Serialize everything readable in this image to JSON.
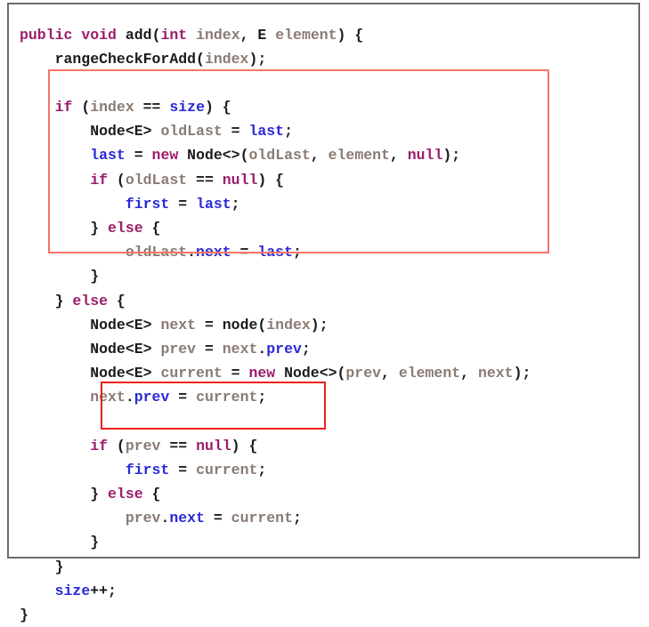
{
  "figure": {
    "kind": "java-source-code-listing",
    "language": "Java",
    "method_signature": "public void add(int index, E element)",
    "border_color": "#6b6b6b",
    "background_color": "#ffffff"
  },
  "syntax_colors": {
    "keyword": "#9B1D6B",
    "field": "#2A2AD6",
    "local_variable": "#8A7B72",
    "plain": "#1b1b1b"
  },
  "annotations": [
    {
      "name": "append-at-tail-highlight",
      "border_color": "#F4756B",
      "covers": "if (index == size) { ... } block"
    },
    {
      "name": "insert-at-head-highlight",
      "border_color": "#F0201C",
      "covers": "if (prev == null) { first = current; }"
    }
  ],
  "code": {
    "lines": [
      [
        {
          "t": "public",
          "c": "kw"
        },
        {
          "t": " ",
          "c": "plain"
        },
        {
          "t": "void",
          "c": "kw"
        },
        {
          "t": " ",
          "c": "plain"
        },
        {
          "t": "add",
          "c": "plain"
        },
        {
          "t": "(",
          "c": "plain"
        },
        {
          "t": "int",
          "c": "kw"
        },
        {
          "t": " ",
          "c": "plain"
        },
        {
          "t": "index",
          "c": "local"
        },
        {
          "t": ", ",
          "c": "plain"
        },
        {
          "t": "E",
          "c": "plain"
        },
        {
          "t": " ",
          "c": "plain"
        },
        {
          "t": "element",
          "c": "local"
        },
        {
          "t": ") {",
          "c": "plain"
        }
      ],
      [
        {
          "t": "    rangeCheckForAdd",
          "c": "plain"
        },
        {
          "t": "(",
          "c": "plain"
        },
        {
          "t": "index",
          "c": "local"
        },
        {
          "t": ");",
          "c": "plain"
        }
      ],
      [],
      [
        {
          "t": "    ",
          "c": "plain"
        },
        {
          "t": "if",
          "c": "kw"
        },
        {
          "t": " (",
          "c": "plain"
        },
        {
          "t": "index",
          "c": "local"
        },
        {
          "t": " == ",
          "c": "plain"
        },
        {
          "t": "size",
          "c": "field"
        },
        {
          "t": ") {",
          "c": "plain"
        }
      ],
      [
        {
          "t": "        Node<E> ",
          "c": "plain"
        },
        {
          "t": "oldLast",
          "c": "local"
        },
        {
          "t": " = ",
          "c": "plain"
        },
        {
          "t": "last",
          "c": "field"
        },
        {
          "t": ";",
          "c": "plain"
        }
      ],
      [
        {
          "t": "        ",
          "c": "plain"
        },
        {
          "t": "last",
          "c": "field"
        },
        {
          "t": " = ",
          "c": "plain"
        },
        {
          "t": "new",
          "c": "kw"
        },
        {
          "t": " Node<>(",
          "c": "plain"
        },
        {
          "t": "oldLast",
          "c": "local"
        },
        {
          "t": ", ",
          "c": "plain"
        },
        {
          "t": "element",
          "c": "local"
        },
        {
          "t": ", ",
          "c": "plain"
        },
        {
          "t": "null",
          "c": "kw"
        },
        {
          "t": ");",
          "c": "plain"
        }
      ],
      [
        {
          "t": "        ",
          "c": "plain"
        },
        {
          "t": "if",
          "c": "kw"
        },
        {
          "t": " (",
          "c": "plain"
        },
        {
          "t": "oldLast",
          "c": "local"
        },
        {
          "t": " == ",
          "c": "plain"
        },
        {
          "t": "null",
          "c": "kw"
        },
        {
          "t": ") {",
          "c": "plain"
        }
      ],
      [
        {
          "t": "            ",
          "c": "plain"
        },
        {
          "t": "first",
          "c": "field"
        },
        {
          "t": " = ",
          "c": "plain"
        },
        {
          "t": "last",
          "c": "field"
        },
        {
          "t": ";",
          "c": "plain"
        }
      ],
      [
        {
          "t": "        } ",
          "c": "plain"
        },
        {
          "t": "else",
          "c": "kw"
        },
        {
          "t": " {",
          "c": "plain"
        }
      ],
      [
        {
          "t": "            ",
          "c": "plain"
        },
        {
          "t": "oldLast",
          "c": "local"
        },
        {
          "t": ".",
          "c": "plain"
        },
        {
          "t": "next",
          "c": "field"
        },
        {
          "t": " = ",
          "c": "plain"
        },
        {
          "t": "last",
          "c": "field"
        },
        {
          "t": ";",
          "c": "plain"
        }
      ],
      [
        {
          "t": "        }",
          "c": "plain"
        }
      ],
      [
        {
          "t": "    } ",
          "c": "plain"
        },
        {
          "t": "else",
          "c": "kw"
        },
        {
          "t": " {",
          "c": "plain"
        }
      ],
      [
        {
          "t": "        Node<E> ",
          "c": "plain"
        },
        {
          "t": "next",
          "c": "local"
        },
        {
          "t": " = ",
          "c": "plain"
        },
        {
          "t": "node",
          "c": "plain"
        },
        {
          "t": "(",
          "c": "plain"
        },
        {
          "t": "index",
          "c": "local"
        },
        {
          "t": ");",
          "c": "plain"
        }
      ],
      [
        {
          "t": "        Node<E> ",
          "c": "plain"
        },
        {
          "t": "prev",
          "c": "local"
        },
        {
          "t": " = ",
          "c": "plain"
        },
        {
          "t": "next",
          "c": "local"
        },
        {
          "t": ".",
          "c": "plain"
        },
        {
          "t": "prev",
          "c": "field"
        },
        {
          "t": ";",
          "c": "plain"
        }
      ],
      [
        {
          "t": "        Node<E> ",
          "c": "plain"
        },
        {
          "t": "current",
          "c": "local"
        },
        {
          "t": " = ",
          "c": "plain"
        },
        {
          "t": "new",
          "c": "kw"
        },
        {
          "t": " Node<>(",
          "c": "plain"
        },
        {
          "t": "prev",
          "c": "local"
        },
        {
          "t": ", ",
          "c": "plain"
        },
        {
          "t": "element",
          "c": "local"
        },
        {
          "t": ", ",
          "c": "plain"
        },
        {
          "t": "next",
          "c": "local"
        },
        {
          "t": ");",
          "c": "plain"
        }
      ],
      [
        {
          "t": "        ",
          "c": "plain"
        },
        {
          "t": "next",
          "c": "local"
        },
        {
          "t": ".",
          "c": "plain"
        },
        {
          "t": "prev",
          "c": "field"
        },
        {
          "t": " = ",
          "c": "plain"
        },
        {
          "t": "current",
          "c": "local"
        },
        {
          "t": ";",
          "c": "plain"
        }
      ],
      [],
      [
        {
          "t": "        ",
          "c": "plain"
        },
        {
          "t": "if",
          "c": "kw"
        },
        {
          "t": " (",
          "c": "plain"
        },
        {
          "t": "prev",
          "c": "local"
        },
        {
          "t": " == ",
          "c": "plain"
        },
        {
          "t": "null",
          "c": "kw"
        },
        {
          "t": ") {",
          "c": "plain"
        }
      ],
      [
        {
          "t": "            ",
          "c": "plain"
        },
        {
          "t": "first",
          "c": "field"
        },
        {
          "t": " = ",
          "c": "plain"
        },
        {
          "t": "current",
          "c": "local"
        },
        {
          "t": ";",
          "c": "plain"
        }
      ],
      [
        {
          "t": "        } ",
          "c": "plain"
        },
        {
          "t": "else",
          "c": "kw"
        },
        {
          "t": " {",
          "c": "plain"
        }
      ],
      [
        {
          "t": "            ",
          "c": "plain"
        },
        {
          "t": "prev",
          "c": "local"
        },
        {
          "t": ".",
          "c": "plain"
        },
        {
          "t": "next",
          "c": "field"
        },
        {
          "t": " = ",
          "c": "plain"
        },
        {
          "t": "current",
          "c": "local"
        },
        {
          "t": ";",
          "c": "plain"
        }
      ],
      [
        {
          "t": "        }",
          "c": "plain"
        }
      ],
      [
        {
          "t": "    }",
          "c": "plain"
        }
      ],
      [
        {
          "t": "    ",
          "c": "plain"
        },
        {
          "t": "size",
          "c": "field"
        },
        {
          "t": "++;",
          "c": "plain"
        }
      ],
      [
        {
          "t": "}",
          "c": "plain"
        }
      ]
    ]
  }
}
